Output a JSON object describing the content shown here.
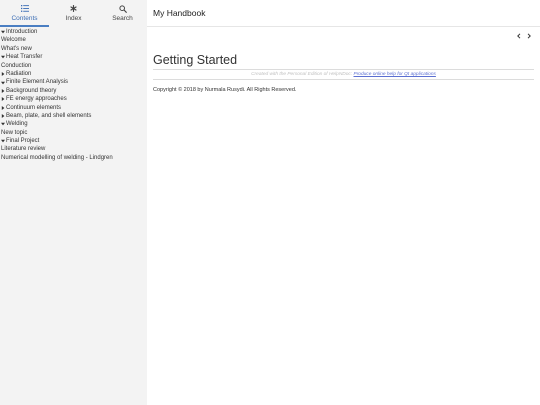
{
  "sidebar": {
    "tabs": [
      {
        "label": "Contents",
        "icon": "list-icon",
        "active": true
      },
      {
        "label": "Index",
        "icon": "asterisk-icon",
        "active": false
      },
      {
        "label": "Search",
        "icon": "search-icon",
        "active": false
      }
    ],
    "toc": [
      {
        "label": "Introduction",
        "arrow": "expanded"
      },
      {
        "label": "Welcome",
        "arrow": "none"
      },
      {
        "label": "What's new",
        "arrow": "none"
      },
      {
        "label": "Heat Transfer",
        "arrow": "expanded"
      },
      {
        "label": "Conduction",
        "arrow": "none"
      },
      {
        "label": "Radiation",
        "arrow": "collapsed"
      },
      {
        "label": "Finite Element Analysis",
        "arrow": "expanded"
      },
      {
        "label": "Background theory",
        "arrow": "collapsed"
      },
      {
        "label": "FE energy approaches",
        "arrow": "collapsed"
      },
      {
        "label": "Continuum elements",
        "arrow": "collapsed"
      },
      {
        "label": "Beam, plate, and shell elements",
        "arrow": "collapsed"
      },
      {
        "label": "Welding",
        "arrow": "expanded"
      },
      {
        "label": "New topic",
        "arrow": "none"
      },
      {
        "label": "Final Project",
        "arrow": "expanded"
      },
      {
        "label": "Literature review",
        "arrow": "none"
      },
      {
        "label": "Numerical modelling of welding - Lindgren",
        "arrow": "none"
      }
    ]
  },
  "header": {
    "title": "My Handbook"
  },
  "nav": {
    "prev_icon": "chevron-left-icon",
    "next_icon": "chevron-right-icon"
  },
  "page": {
    "title": "Getting Started",
    "creator_text": "Created with the Personal Edition of HelpNDoc:",
    "creator_link": "Produce online help for Qt applications",
    "copyright": "Copyright © 2018 by Nurmala Rusydi. All Rights Reserved."
  },
  "colors": {
    "accent": "#4a7ec2",
    "sidebar_bg": "#f3f3f3",
    "link": "#5b6fd1",
    "muted_text": "#c0c0c0"
  }
}
